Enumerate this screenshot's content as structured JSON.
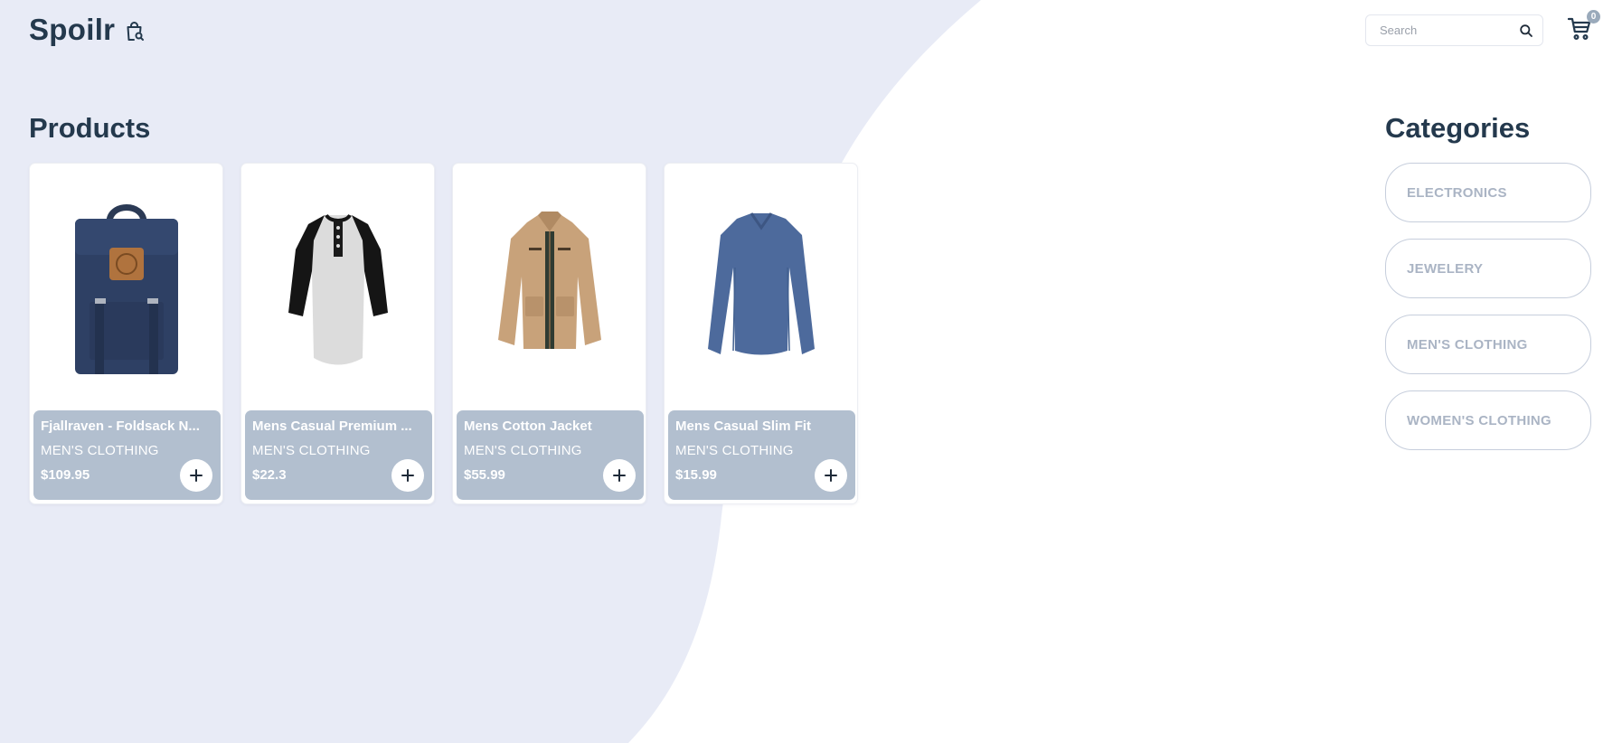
{
  "brand": {
    "name": "Spoilr",
    "icon": "shopping-bag-search-icon"
  },
  "search": {
    "placeholder": "Search",
    "icon": "search-icon"
  },
  "cart": {
    "icon": "cart-icon",
    "count": "0"
  },
  "products_section": {
    "title": "Products",
    "items": [
      {
        "title": "Fjallraven - Foldsack N...",
        "category": "MEN'S CLOTHING",
        "price": "$109.95",
        "image": "navy-backpack",
        "add_icon": "plus-icon"
      },
      {
        "title": "Mens Casual Premium ...",
        "category": "MEN'S CLOTHING",
        "price": "$22.3",
        "image": "raglan-henley-shirt",
        "add_icon": "plus-icon"
      },
      {
        "title": "Mens Cotton Jacket",
        "category": "MEN'S CLOTHING",
        "price": "$55.99",
        "image": "khaki-cotton-jacket",
        "add_icon": "plus-icon"
      },
      {
        "title": "Mens Casual Slim Fit",
        "category": "MEN'S CLOTHING",
        "price": "$15.99",
        "image": "blue-longsleeve-tshirt",
        "add_icon": "plus-icon"
      }
    ]
  },
  "categories_section": {
    "title": "Categories",
    "items": [
      "ELECTRONICS",
      "JEWELERY",
      "MEN'S CLOTHING",
      "WOMEN'S CLOTHING"
    ]
  },
  "colors": {
    "background_blob": "#e8ebf6",
    "heading": "#24394d",
    "card_info": "#b2bfcf",
    "category_text": "#aab4c4"
  }
}
